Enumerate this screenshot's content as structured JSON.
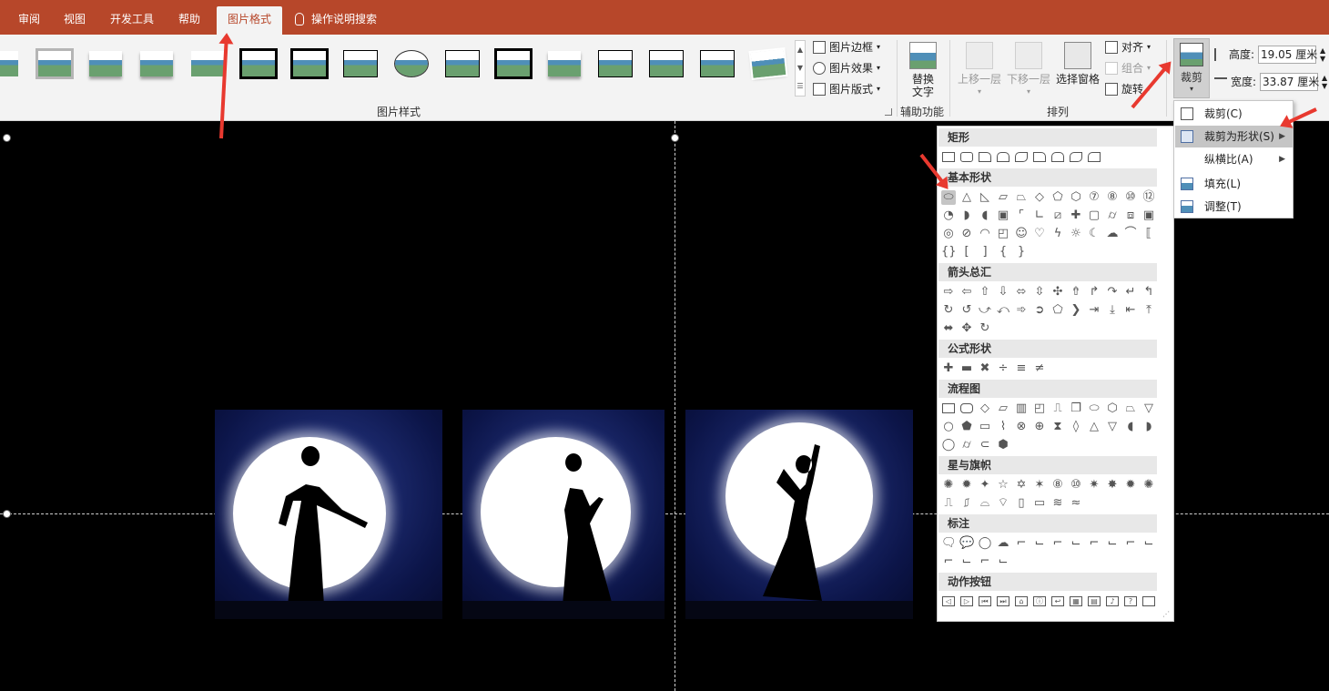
{
  "tabs": [
    "审阅",
    "视图",
    "开发工具",
    "帮助",
    "图片格式"
  ],
  "active_tab": "图片格式",
  "tell_me": "操作说明搜索",
  "ribbon": {
    "picture_styles_label": "图片样式",
    "picture_border": "图片边框",
    "picture_effects": "图片效果",
    "picture_layout": "图片版式",
    "alt_text_line1": "替换",
    "alt_text_line2": "文字",
    "accessibility_label": "辅助功能",
    "bring_forward": "上移一层",
    "send_backward": "下移一层",
    "selection_pane": "选择窗格",
    "align": "对齐",
    "group": "组合",
    "rotate": "旋转",
    "arrange_label": "排列",
    "crop": "裁剪",
    "height_label": "高度:",
    "height_value": "19.05 厘米",
    "width_label": "宽度:",
    "width_value": "33.87 厘米"
  },
  "crop_menu": {
    "items": [
      "裁剪(C)",
      "裁剪为形状(S)",
      "纵横比(A)",
      "填充(L)",
      "调整(T)"
    ],
    "highlighted": "裁剪为形状(S)"
  },
  "shape_menu": {
    "sections": [
      "矩形",
      "基本形状",
      "箭头总汇",
      "公式形状",
      "流程图",
      "星与旗帜",
      "标注",
      "动作按钮"
    ]
  },
  "colors": {
    "accent": "#b7472a",
    "arrow": "#e8392f"
  }
}
